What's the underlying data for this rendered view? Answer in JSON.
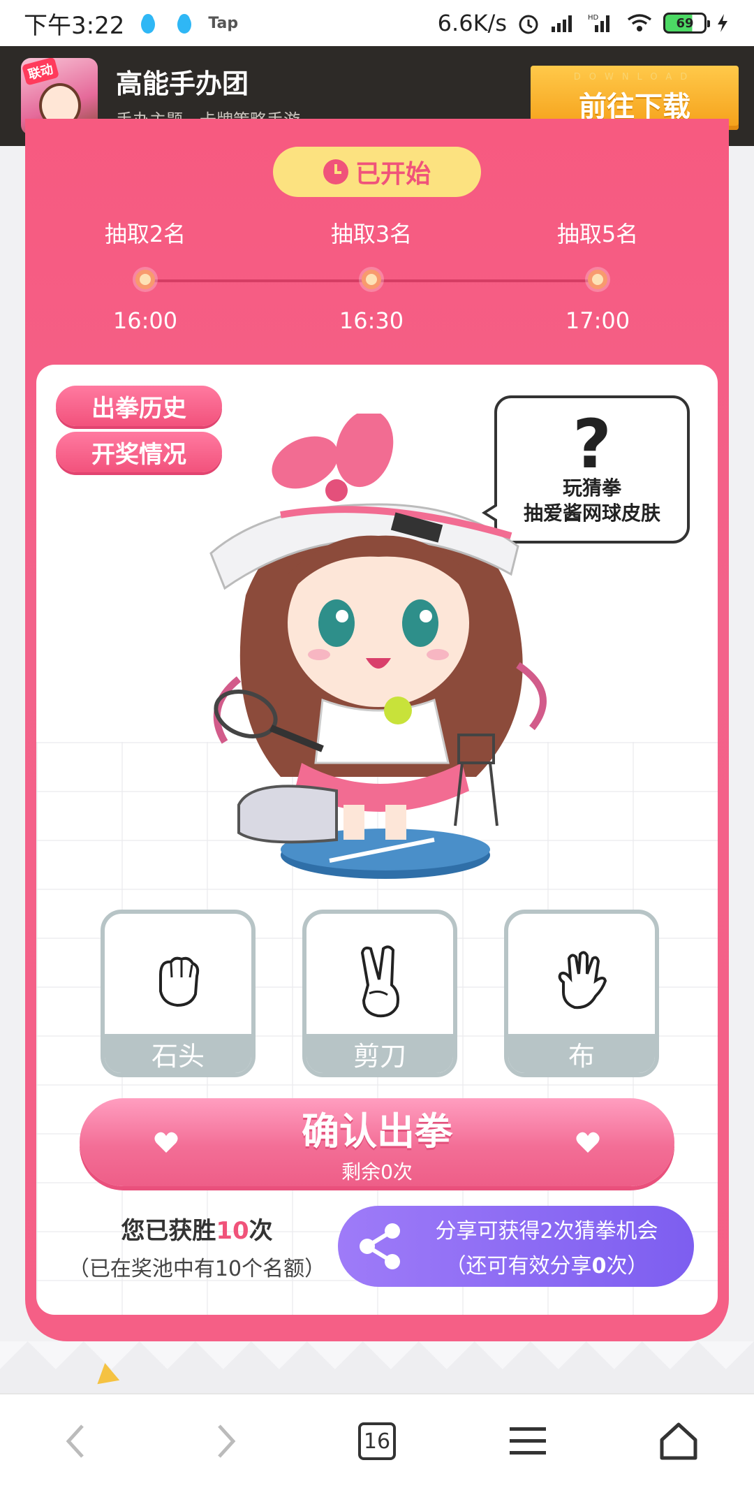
{
  "status_bar": {
    "time": "下午3:22",
    "notif_app": "Tap",
    "network_speed": "6.6K/s",
    "battery": "69"
  },
  "ad_banner": {
    "title": "高能手办团",
    "subtitle": "手办主题，卡牌策略手游",
    "icon_tag": "联动",
    "download_small": "DOWNLOAD",
    "download_label": "前往下载"
  },
  "event": {
    "status": "已开始",
    "timeline": [
      {
        "label": "抽取2名",
        "time": "16:00"
      },
      {
        "label": "抽取3名",
        "time": "16:30"
      },
      {
        "label": "抽取5名",
        "time": "17:00"
      }
    ]
  },
  "panel": {
    "history_button": "出拳历史",
    "lottery_button": "开奖情况",
    "bubble_mark": "?",
    "bubble_line1": "玩猜拳",
    "bubble_line2": "抽爱酱网球皮肤",
    "choices": [
      {
        "label": "石头",
        "icon": "fist-icon"
      },
      {
        "label": "剪刀",
        "icon": "scissors-hand-icon"
      },
      {
        "label": "布",
        "icon": "open-hand-icon"
      }
    ],
    "confirm_label": "确认出拳",
    "remaining": "剩余0次",
    "win_prefix": "您已获胜",
    "win_count": "10",
    "win_suffix": "次",
    "win_sub": "（已在奖池中有10个名额）",
    "share_line1": "分享可获得2次猜拳机会",
    "share_line2_prefix": "（还可有效分享",
    "share_count": "0",
    "share_line2_suffix": "次）"
  },
  "bottom_nav": {
    "tab_count": "16"
  },
  "colors": {
    "accent_pink": "#f3628a",
    "pill_yellow": "#fce280",
    "share_purple": "#8a68f3",
    "download_orange": "#f5a019"
  }
}
